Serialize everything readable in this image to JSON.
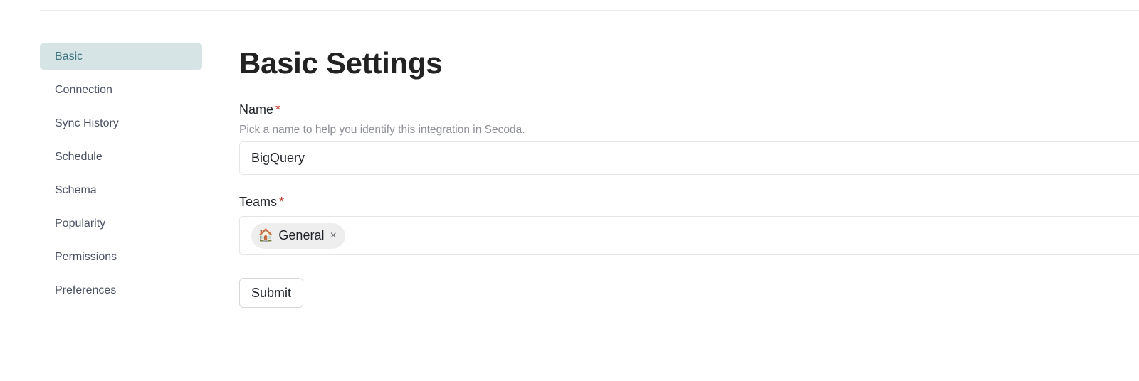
{
  "sidebar": {
    "items": [
      {
        "label": "Basic",
        "active": true
      },
      {
        "label": "Connection"
      },
      {
        "label": "Sync History"
      },
      {
        "label": "Schedule"
      },
      {
        "label": "Schema"
      },
      {
        "label": "Popularity"
      },
      {
        "label": "Permissions"
      },
      {
        "label": "Preferences"
      }
    ]
  },
  "main": {
    "title": "Basic Settings",
    "name_field": {
      "label": "Name",
      "required_mark": "*",
      "description": "Pick a name to help you identify this integration in Secoda.",
      "value": "BigQuery"
    },
    "teams_field": {
      "label": "Teams",
      "required_mark": "*",
      "chips": [
        {
          "emoji": "🏠",
          "label": "General",
          "remove_glyph": "×",
          "icon": "house-emoji-icon"
        }
      ]
    },
    "submit_label": "Submit"
  },
  "colors": {
    "active_nav_bg": "#d6e4e5",
    "active_nav_text": "#3d7480",
    "required": "#c0392b"
  }
}
